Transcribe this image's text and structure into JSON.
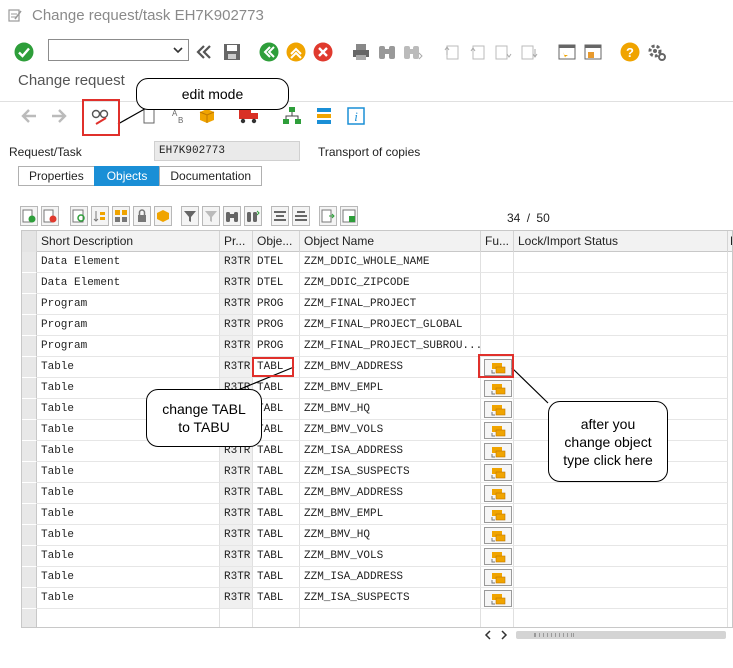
{
  "window": {
    "title": "Change request/task EH7K902773"
  },
  "screen": {
    "title": "Change request"
  },
  "fields": {
    "request_label": "Request/Task",
    "request_value": "EH7K902773",
    "request_desc": "Transport of copies"
  },
  "tabs": [
    {
      "label": "Properties",
      "active": false
    },
    {
      "label": "Objects",
      "active": true
    },
    {
      "label": "Documentation",
      "active": false
    }
  ],
  "counter": {
    "current": "34",
    "sep": "/",
    "total": "50"
  },
  "grid": {
    "headers": [
      "Short Description",
      "Pr...",
      "Obje...",
      "Object Name",
      "Fu...",
      "Lock/Import Status",
      "L"
    ],
    "rows": [
      {
        "desc": "Data Element",
        "pgmid": "R3TR",
        "obj": "DTEL",
        "name": "ZZM_DDIC_WHOLE_NAME",
        "func": false
      },
      {
        "desc": "Data Element",
        "pgmid": "R3TR",
        "obj": "DTEL",
        "name": "ZZM_DDIC_ZIPCODE",
        "func": false
      },
      {
        "desc": "Program",
        "pgmid": "R3TR",
        "obj": "PROG",
        "name": "ZZM_FINAL_PROJECT",
        "func": false
      },
      {
        "desc": "Program",
        "pgmid": "R3TR",
        "obj": "PROG",
        "name": "ZZM_FINAL_PROJECT_GLOBAL",
        "func": false
      },
      {
        "desc": "Program",
        "pgmid": "R3TR",
        "obj": "PROG",
        "name": "ZZM_FINAL_PROJECT_SUBROU...",
        "func": false
      },
      {
        "desc": "Table",
        "pgmid": "R3TR",
        "obj": "TABL",
        "name": "ZZM_BMV_ADDRESS",
        "func": true
      },
      {
        "desc": "Table",
        "pgmid": "R3TR",
        "obj": "TABL",
        "name": "ZZM_BMV_EMPL",
        "func": true
      },
      {
        "desc": "Table",
        "pgmid": "R3TR",
        "obj": "TABL",
        "name": "ZZM_BMV_HQ",
        "func": true
      },
      {
        "desc": "Table",
        "pgmid": "R3TR",
        "obj": "TABL",
        "name": "ZZM_BMV_VOLS",
        "func": true
      },
      {
        "desc": "Table",
        "pgmid": "R3TR",
        "obj": "TABL",
        "name": "ZZM_ISA_ADDRESS",
        "func": true
      },
      {
        "desc": "Table",
        "pgmid": "R3TR",
        "obj": "TABL",
        "name": "ZZM_ISA_SUSPECTS",
        "func": true
      },
      {
        "desc": "Table",
        "pgmid": "R3TR",
        "obj": "TABL",
        "name": "ZZM_BMV_ADDRESS",
        "func": true
      },
      {
        "desc": "Table",
        "pgmid": "R3TR",
        "obj": "TABL",
        "name": "ZZM_BMV_EMPL",
        "func": true
      },
      {
        "desc": "Table",
        "pgmid": "R3TR",
        "obj": "TABL",
        "name": "ZZM_BMV_HQ",
        "func": true
      },
      {
        "desc": "Table",
        "pgmid": "R3TR",
        "obj": "TABL",
        "name": "ZZM_BMV_VOLS",
        "func": true
      },
      {
        "desc": "Table",
        "pgmid": "R3TR",
        "obj": "TABL",
        "name": "ZZM_ISA_ADDRESS",
        "func": true
      },
      {
        "desc": "Table",
        "pgmid": "R3TR",
        "obj": "TABL",
        "name": "ZZM_ISA_SUSPECTS",
        "func": true
      }
    ]
  },
  "annotations": {
    "edit_mode": "edit mode",
    "change_tabl": "change TABL to TABU",
    "after_change": "after you change object type click here"
  },
  "colors": {
    "accent": "#1a8fd6",
    "highlight": "#e0302b",
    "ok_green": "#2e9e3a",
    "cancel_red": "#e03a2e",
    "nav_orange": "#f0a400"
  }
}
